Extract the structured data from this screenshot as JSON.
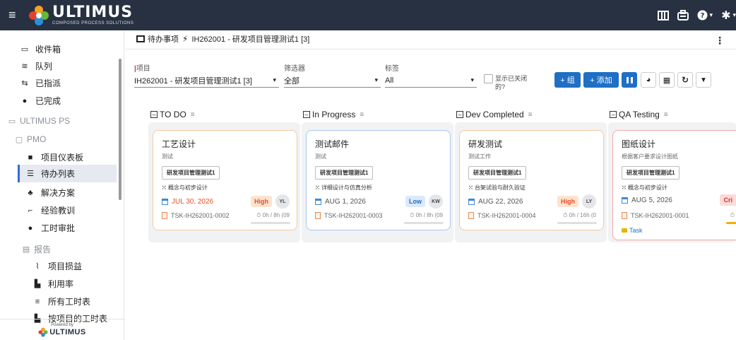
{
  "brand": {
    "name": "ULTIMUS",
    "subtitle": "COMPOSED PROCESS SOLUTIONS",
    "powered_by": "Powered by",
    "powered_name": "ULTIMUS"
  },
  "topbar": {
    "icons": [
      "columns-icon",
      "briefcase-icon",
      "help-icon",
      "settings-icon"
    ]
  },
  "sidebar": {
    "items": [
      {
        "label": "收件箱",
        "icon": "inbox-icon"
      },
      {
        "label": "队列",
        "icon": "stack-icon"
      },
      {
        "label": "已指派",
        "icon": "assign-icon"
      },
      {
        "label": "已完成",
        "icon": "check-circle-icon"
      }
    ],
    "section_ps": "ULTIMUS PS",
    "section_pmo": "PMO",
    "pmo_items": [
      {
        "label": "项目仪表板",
        "icon": "dashboard-icon"
      },
      {
        "label": "待办列表",
        "icon": "list-icon"
      },
      {
        "label": "解决方案",
        "icon": "group-icon"
      },
      {
        "label": "经验教训",
        "icon": "lesson-icon"
      },
      {
        "label": "工时审批",
        "icon": "check-circle-icon"
      }
    ],
    "section_report": "报告",
    "report_items": [
      {
        "label": "项目损益",
        "icon": "line-chart-icon"
      },
      {
        "label": "利用率",
        "icon": "file-icon"
      },
      {
        "label": "所有工时表",
        "icon": "table-icon"
      },
      {
        "label": "按项目的工时表",
        "icon": "bar-chart-icon"
      }
    ]
  },
  "breadcrumb": {
    "part1": "待办事项",
    "part2": "IH262001 - 研发项目管理测试1 [3]"
  },
  "filters": {
    "project_label": "项目",
    "project_value": "IH262001 - 研发项目管理测试1 [3]",
    "filter_label": "筛选器",
    "filter_value": "全部",
    "tag_label": "标签",
    "tag_value": "All",
    "show_closed_line1": "显示已关闭",
    "show_closed_line2": "的?"
  },
  "toolbar": {
    "add_group": "+ 组",
    "add": "+ 添加"
  },
  "columns": [
    {
      "title": "TO DO",
      "card": {
        "title": "工艺设计",
        "desc": "测试",
        "tag": "研发项目管理测试1",
        "phase": "概念与初步设计",
        "date": "JUL 30, 2026",
        "priority": "High",
        "avatar": "YL",
        "task_id": "TSK-IH262001-0002",
        "hours": "⏱ 0h / 8h (09"
      }
    },
    {
      "title": "In Progress",
      "card": {
        "title": "测试邮件",
        "desc": "测试",
        "tag": "研发项目管理测试1",
        "phase": "详细设计与仿真分析",
        "date": "AUG 1, 2026",
        "priority": "Low",
        "avatar": "KW",
        "task_id": "TSK-IH262001-0003",
        "hours": "⏱ 0h / 8h (09"
      }
    },
    {
      "title": "Dev Completed",
      "card": {
        "title": "研发测试",
        "desc": "测试工作",
        "tag": "研发项目管理测试1",
        "phase": "台架试验与耐久验证",
        "date": "AUG 22, 2026",
        "priority": "High",
        "avatar": "LY",
        "task_id": "TSK-IH262001-0004",
        "hours": "⏱ 0h / 16h (0"
      }
    },
    {
      "title": "QA Testing",
      "card": {
        "title": "图纸设计",
        "desc": "根据客户要求设计图纸",
        "tag": "研发项目管理测试1",
        "phase": "概念与初步设计",
        "date": "AUG 5, 2026",
        "priority": "Cri",
        "task_id": "TSK-IH262001-0001",
        "hours": "⏱",
        "type": "Task"
      }
    }
  ],
  "colors": {
    "topbar": "#273142",
    "primary": "#1f6fc5",
    "todo_border": "#f7c99e",
    "progress_border": "#a9c8ef",
    "dev_border": "#f7c99e",
    "qa_border": "#f2a8a8",
    "high": "#fde3cf",
    "low": "#dbe9fb"
  }
}
